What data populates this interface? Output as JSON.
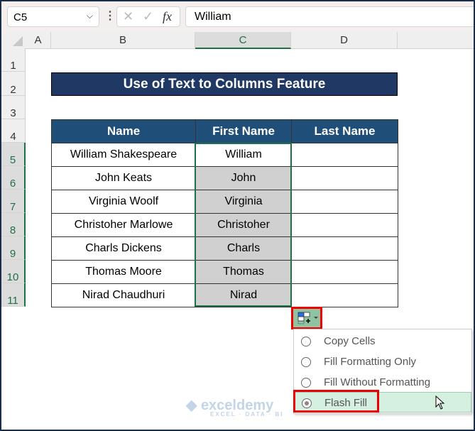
{
  "formula_bar": {
    "name_box": "C5",
    "cancel_icon": "✕",
    "enter_icon": "✓",
    "fx": "fx",
    "value": "William"
  },
  "columns": [
    "A",
    "B",
    "C",
    "D"
  ],
  "rows": [
    "1",
    "2",
    "3",
    "4",
    "5",
    "6",
    "7",
    "8",
    "9",
    "10",
    "11"
  ],
  "title": "Use of Text to Columns Feature",
  "table": {
    "headers": [
      "Name",
      "First Name",
      "Last Name"
    ],
    "rows": [
      [
        "William Shakespeare",
        "William",
        ""
      ],
      [
        "John Keats",
        "John",
        ""
      ],
      [
        "Virginia Woolf",
        "Virginia",
        ""
      ],
      [
        "Christoher Marlowe",
        "Christoher",
        ""
      ],
      [
        "Charls Dickens",
        "Charls",
        ""
      ],
      [
        "Thomas Moore",
        "Thomas",
        ""
      ],
      [
        "Nirad Chaudhuri",
        "Nirad",
        ""
      ]
    ]
  },
  "autofill_menu": {
    "items": [
      "Copy Cells",
      "Fill Formatting Only",
      "Fill Without Formatting",
      "Flash Fill"
    ],
    "selected": "Flash Fill"
  },
  "watermark": {
    "name": "exceldemy",
    "tagline": "EXCEL · DATA · BI"
  },
  "colors": {
    "title_bg": "#1f3864",
    "header_bg": "#1f4e79",
    "selection": "#1e7145",
    "highlight": "#ee0000"
  }
}
